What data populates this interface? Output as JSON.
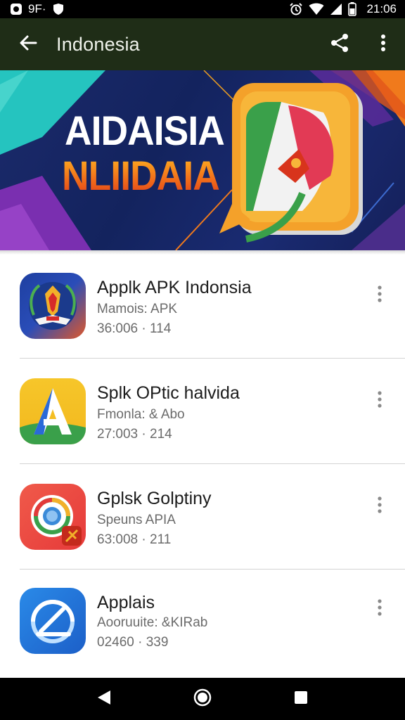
{
  "status_bar": {
    "left_text": "9F·",
    "time": "21:06",
    "icons": [
      "notification-icon",
      "shield-icon",
      "alarm-icon",
      "wifi-icon",
      "signal-icon",
      "battery-icon"
    ]
  },
  "app_bar": {
    "title": "Indonesia",
    "icons": [
      "back-arrow-icon",
      "share-icon",
      "more-vert-icon"
    ]
  },
  "banner": {
    "line1": "AIDAISIA",
    "line2": "NLIIDAIA",
    "colors": {
      "bg": "#1a2a6c",
      "orange": "#f07a1c",
      "teal": "#29c7c0",
      "purple": "#6b2fa8"
    }
  },
  "apps": [
    {
      "title": "Applk APK Indonsia",
      "subtitle": "Mamois: APK",
      "meta": "36:006 · 114",
      "icon": "emblem-app-icon"
    },
    {
      "title": "Splk OPtic halvida",
      "subtitle": "Fmonla: & Abo",
      "meta": "27:003 · 214",
      "icon": "letter-a-app-icon"
    },
    {
      "title": "Gplsk Golptiny",
      "subtitle": "Speuns APIA",
      "meta": "63:008 · 211",
      "icon": "ring-app-icon"
    },
    {
      "title": "Applais",
      "subtitle": "Aooruuite: &KIRab",
      "meta": "02460 · 339",
      "icon": "gauge-app-icon"
    }
  ],
  "nav_bar": {
    "icons": [
      "back-triangle-icon",
      "home-circle-icon",
      "recents-square-icon"
    ]
  }
}
